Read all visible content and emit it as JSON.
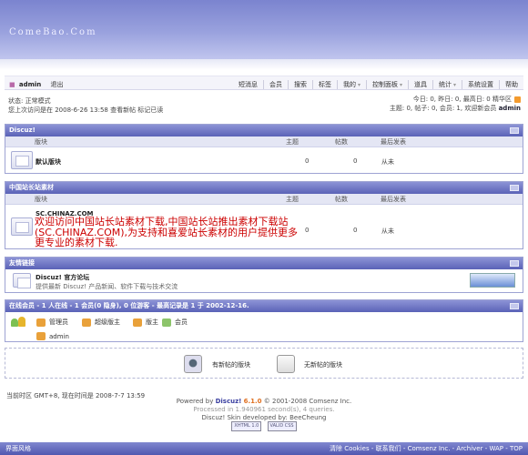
{
  "banner": {
    "logo": "ComeBao.Com"
  },
  "userbar": {
    "username": "admin",
    "logout": "退出",
    "nav": [
      "短消息",
      "会员",
      "搜索",
      "标签",
      "我的",
      "控制面板",
      "道具",
      "统计",
      "系统设置",
      "帮助"
    ],
    "dropdown_items": [
      "我的",
      "控制面板",
      "统计"
    ]
  },
  "status": {
    "mode": "状态: 正常模式",
    "last_visit": "您上次访问是在 2008-6-26 13:58 查看新帖  标记已读",
    "stats_line1": "今日: 0, 昨日: 0, 最高日: 0",
    "archive": "精华区",
    "stats_line2": "主题: 0, 帖子: 0, 会员: 1, 欢迎新会员",
    "new_member": "admin"
  },
  "columns": {
    "forum": "版块",
    "threads": "主题",
    "posts": "帖数",
    "last": "最后发表"
  },
  "cat1": {
    "title": "Discuz!",
    "forum_name": "默认版块",
    "threads": "0",
    "posts": "0",
    "last": "从未"
  },
  "cat2": {
    "title": "中国站长站素材",
    "forum_name": "SC.CHINAZ.COM",
    "promo": "欢迎访问中国站长站素材下载,中国站长站推出素材下载站(SC.CHINAZ.COM),为支持和喜爱站长素材的用户提供更多更专业的素材下载.",
    "threads": "0",
    "posts": "0",
    "last": "从未"
  },
  "links": {
    "title": "友情链接",
    "site_name": "Discuz! 官方论坛",
    "site_desc": "提供最新 Discuz! 产品新闻、软件下载与技术交流"
  },
  "online": {
    "title": "在线会员 - 1 人在线 - 1 会员(0 隐身), 0 位游客 - 最高记录是 1 于 2002-12-16.",
    "legend": [
      {
        "label": "管理员",
        "color": "#e0a020"
      },
      {
        "label": "超级版主",
        "color": "#e0a020"
      },
      {
        "label": "版主",
        "color": "#e0a020"
      },
      {
        "label": "会员",
        "color": "#e0a020"
      }
    ],
    "online_user": "admin"
  },
  "newpost": {
    "has_new": "有新帖的版块",
    "no_new": "无新帖的版块"
  },
  "footer": {
    "timezone": "当前时区  GMT+8, 现在时间是 2008-7-7 13:59",
    "powered_prefix": "Powered by",
    "product": "Discuz!",
    "version": "6.1.0",
    "copyright": "© 2001-2008 Comsenz Inc.",
    "processed": "Processed in 1.940961 second(s), 4 queries.",
    "skin": "Discuz! Skin developed by: BeeCheung",
    "badges": [
      "XHTML 1.0",
      "VALID CSS"
    ]
  },
  "bottombar": {
    "left": "界面风格",
    "right": "清除 Cookies - 联系我们 - Comsenz Inc. - Archiver - WAP - TOP"
  }
}
